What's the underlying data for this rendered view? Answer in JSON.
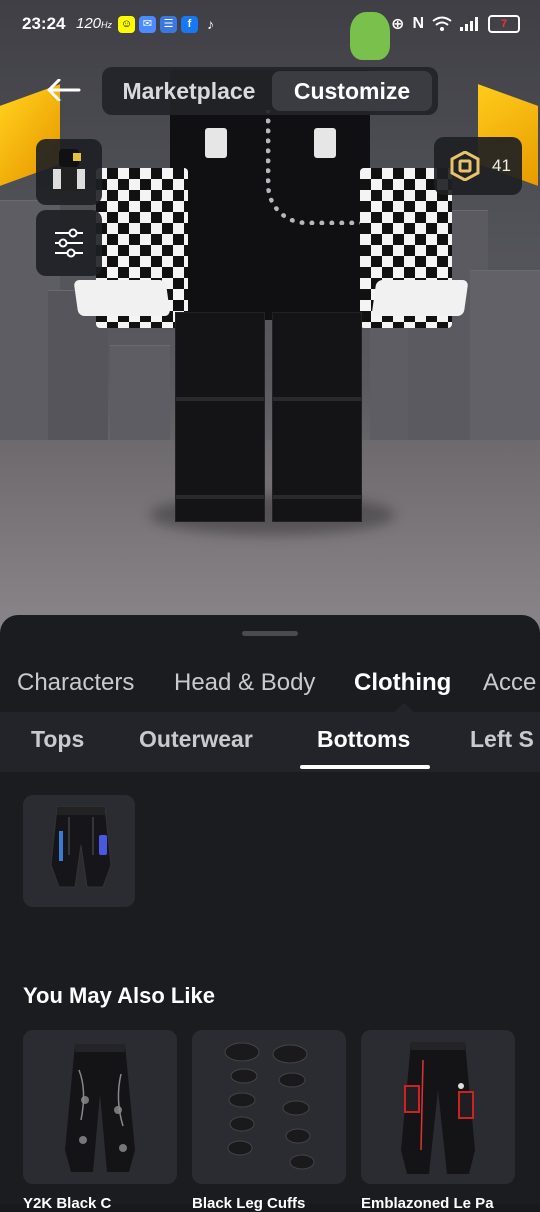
{
  "status_bar": {
    "time": "23:24",
    "refresh_rate": "120",
    "battery": "7",
    "apps": [
      "snapchat-icon",
      "messenger-icon",
      "chat-icon",
      "facebook-icon",
      "tiktok-icon"
    ]
  },
  "header": {
    "back_icon": "back-arrow-icon",
    "tabs": [
      {
        "label": "Marketplace",
        "active": false
      },
      {
        "label": "Customize",
        "active": true
      }
    ]
  },
  "robux": {
    "icon": "robux-icon",
    "amount": "41"
  },
  "side_buttons": [
    {
      "name": "avatar-thumbnail",
      "icon": "avatar-thumbnail-icon"
    },
    {
      "name": "filters",
      "icon": "sliders-icon"
    }
  ],
  "categories": [
    {
      "label": "Characters",
      "active": false
    },
    {
      "label": "Head & Body",
      "active": false
    },
    {
      "label": "Clothing",
      "active": true
    },
    {
      "label": "Acce",
      "active": false
    }
  ],
  "subcategories": [
    {
      "label": "Tops",
      "active": false
    },
    {
      "label": "Outerwear",
      "active": false
    },
    {
      "label": "Bottoms",
      "active": true
    },
    {
      "label": "Left S",
      "active": false
    }
  ],
  "owned_items": [
    {
      "icon": "black-pants-icon"
    }
  ],
  "recommendations": {
    "title": "You May Also Like",
    "items": [
      {
        "name": "Y2K Black C",
        "icon": "black-cargo-pants-icon"
      },
      {
        "name": "Black Leg Cuffs",
        "icon": "leg-cuffs-icon"
      },
      {
        "name": "Emblazoned Le Pa",
        "icon": "red-detail-pants-icon"
      }
    ]
  },
  "colors": {
    "panel": "#1b1c20",
    "subnav": "#23242a",
    "tile": "#2b2c32",
    "robux_gold": "#e8c36a"
  }
}
